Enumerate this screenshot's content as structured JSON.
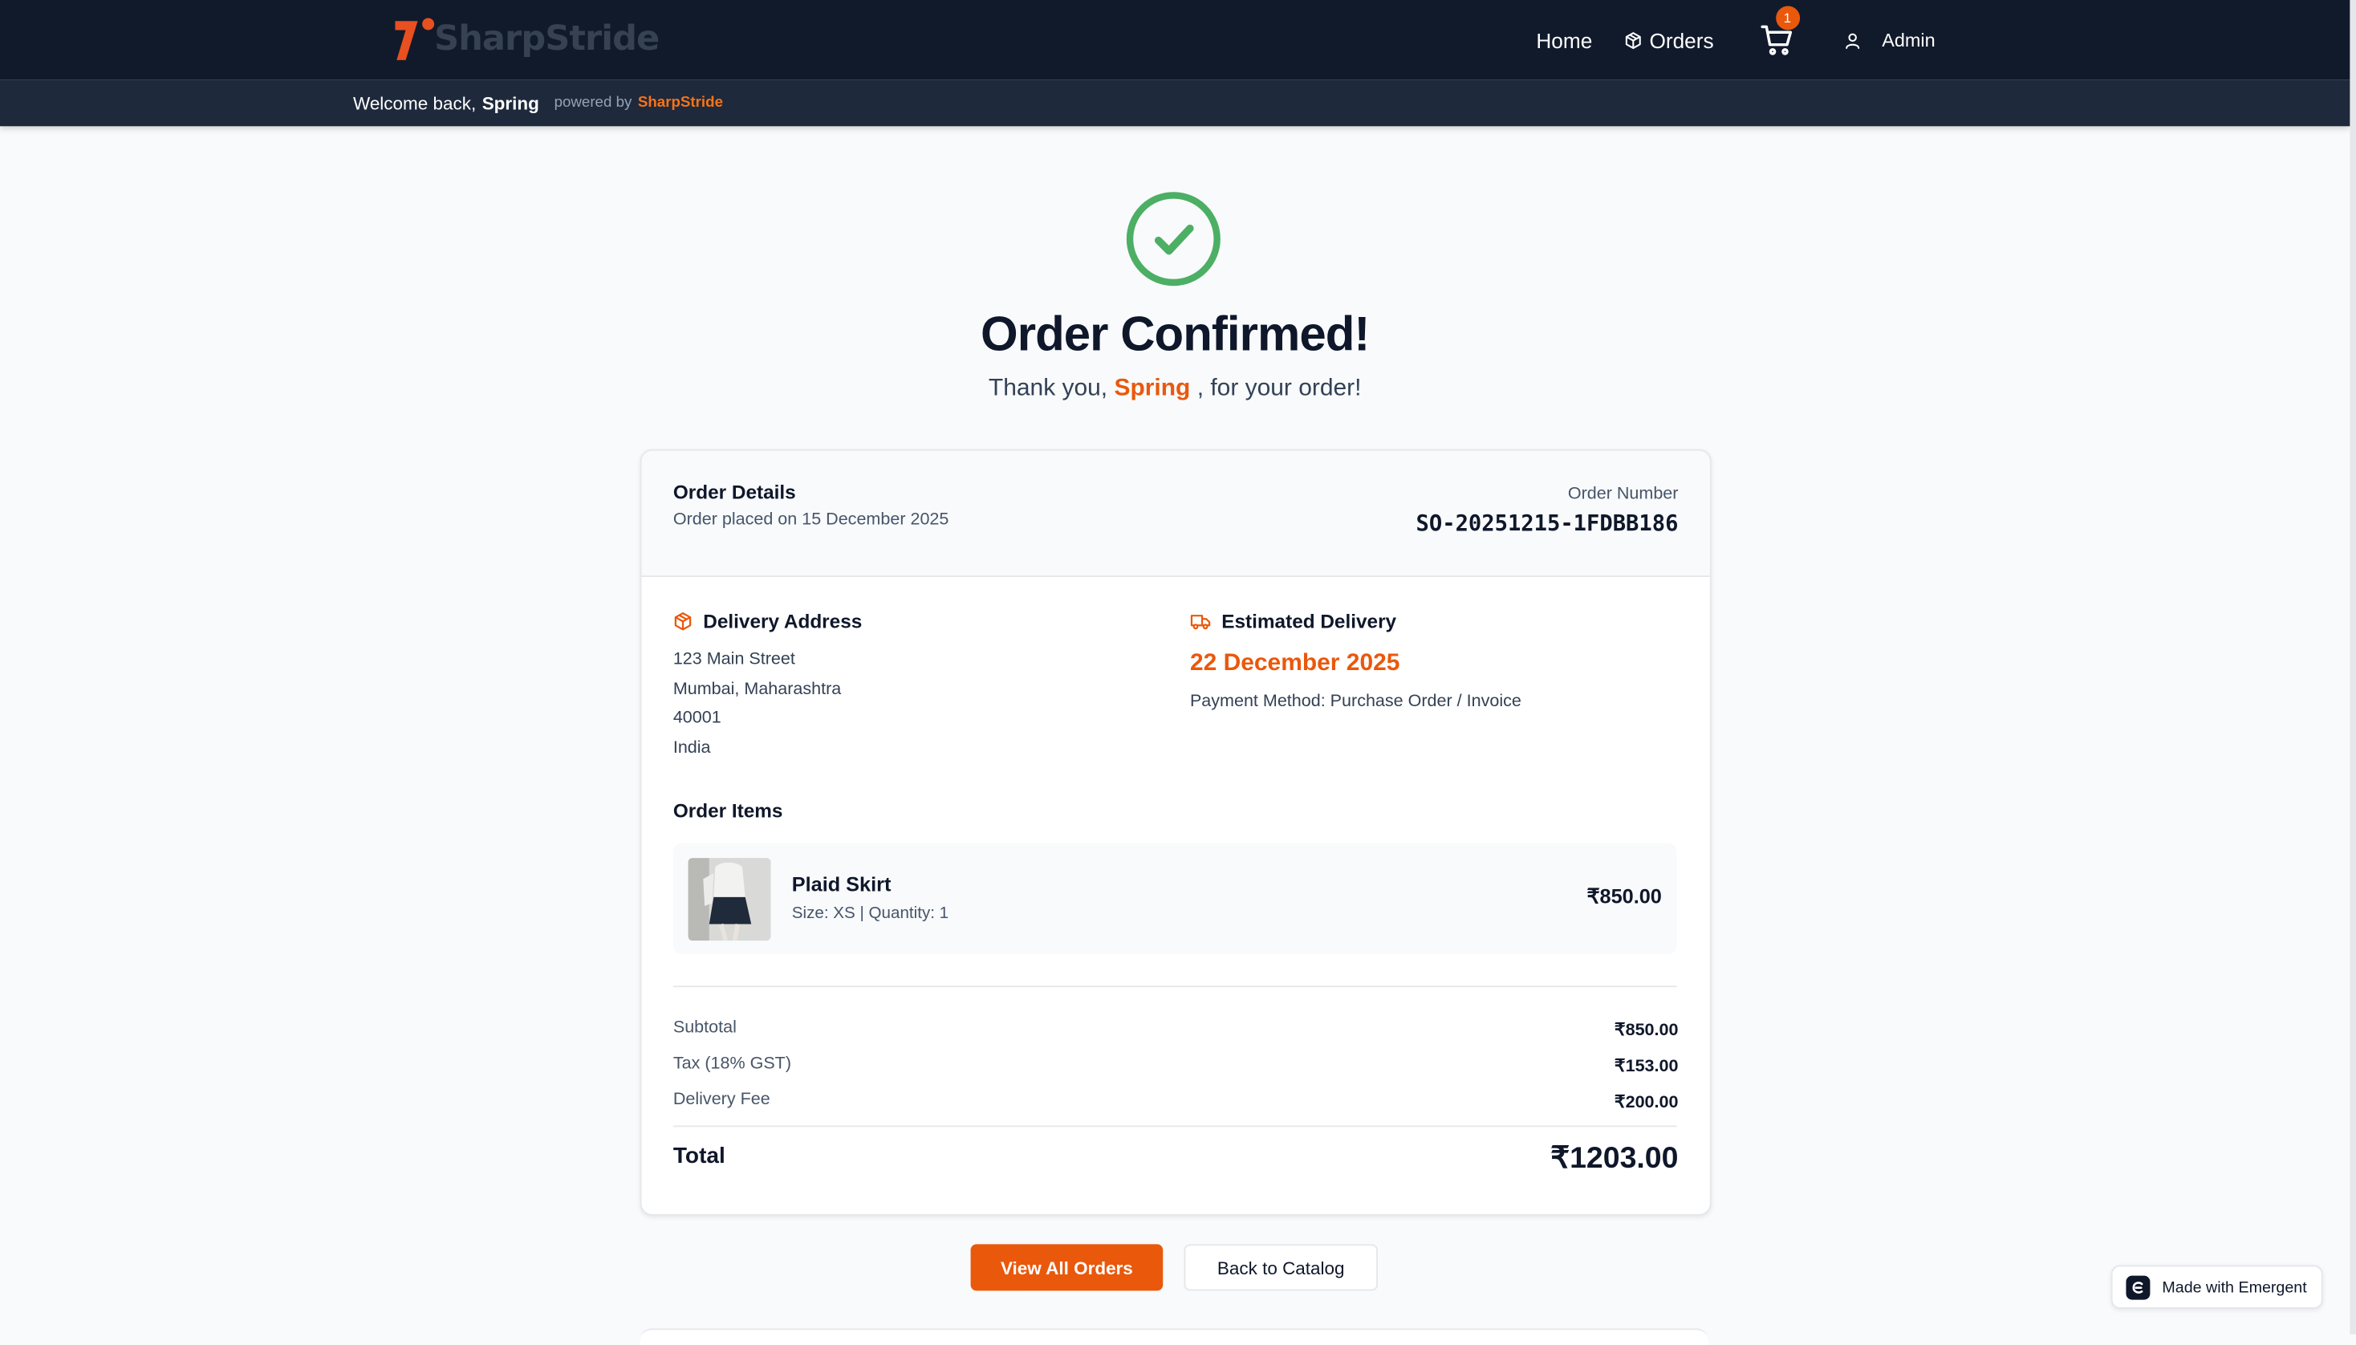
{
  "header": {
    "brand": "SharpStride",
    "nav": {
      "home": "Home",
      "orders": "Orders"
    },
    "cart_count": "1",
    "user_label": "Admin"
  },
  "subheader": {
    "welcome": "Welcome back,",
    "user_name": "Spring",
    "powered_by": "powered by",
    "powered_brand": "SharpStride"
  },
  "confirmation": {
    "title": "Order Confirmed!",
    "thanks_prefix": "Thank you,",
    "thanks_name": "Spring",
    "thanks_suffix": ", for your order!"
  },
  "order": {
    "details_title": "Order Details",
    "placed_on": "Order placed on 15 December 2025",
    "number_label": "Order Number",
    "number": "SO-20251215-1FDBB186"
  },
  "delivery_address": {
    "title": "Delivery Address",
    "lines": [
      "123 Main Street",
      "Mumbai, Maharashtra",
      "40001",
      "India"
    ]
  },
  "estimated_delivery": {
    "title": "Estimated Delivery",
    "date": "22 December 2025",
    "payment": "Payment Method: Purchase Order / Invoice"
  },
  "items": {
    "title": "Order Items",
    "list": [
      {
        "name": "Plaid Skirt",
        "meta": "Size: XS | Quantity: 1",
        "price": "₹850.00"
      }
    ]
  },
  "summary": {
    "subtotal_label": "Subtotal",
    "subtotal": "₹850.00",
    "tax_label": "Tax (18% GST)",
    "tax": "₹153.00",
    "delivery_label": "Delivery Fee",
    "delivery": "₹200.00",
    "total_label": "Total",
    "total": "₹1203.00"
  },
  "actions": {
    "view_orders": "View All Orders",
    "back_catalog": "Back to Catalog"
  },
  "badge": {
    "label": "Made with Emergent"
  },
  "colors": {
    "accent": "#ea580c",
    "success": "#4caf64",
    "topbar": "#111a2b",
    "subbar": "#1e293b"
  }
}
